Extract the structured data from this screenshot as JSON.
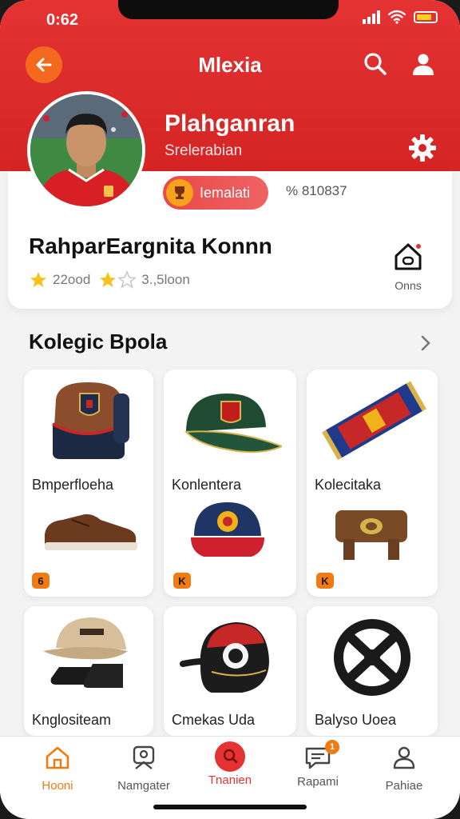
{
  "status": {
    "time": "0:62"
  },
  "header": {
    "title": "Mlexia"
  },
  "profile": {
    "name": "Plahganran",
    "subtitle": "Srelerabian",
    "pill_label": "Iemalati",
    "pill_code": "% 810837"
  },
  "card": {
    "title": "RahparEargnita Konnn",
    "rating_1_text": "22ood",
    "rating_2_text": "3.,5loon",
    "home_label": "Onns"
  },
  "collection": {
    "title": "Kolegic Bpola",
    "items": [
      {
        "label": "Bmperfloeha",
        "badge": "6"
      },
      {
        "label": "Konlentera",
        "badge": "K"
      },
      {
        "label": "Kolecitaka",
        "badge": "K"
      },
      {
        "label": "Knglositeam"
      },
      {
        "label": "Cmekas Uda"
      },
      {
        "label": "Balyso Uoea"
      }
    ]
  },
  "nav": {
    "items": [
      {
        "label": "Hooni"
      },
      {
        "label": "Namgater"
      },
      {
        "label": "Tnanien"
      },
      {
        "label": "Rapami",
        "badge": "1"
      },
      {
        "label": "Pahiae"
      }
    ]
  },
  "colors": {
    "brand_red": "#e53333",
    "accent_orange": "#f36a1f",
    "star_yellow": "#f6c21c"
  },
  "icons": [
    "back-arrow-icon",
    "search-icon",
    "user-icon",
    "gear-icon",
    "trophy-icon",
    "star-icon",
    "home-icon",
    "chevron-right-icon",
    "nav-home-icon",
    "nav-navigator-icon",
    "nav-training-icon",
    "nav-messages-icon",
    "nav-profile-icon"
  ]
}
